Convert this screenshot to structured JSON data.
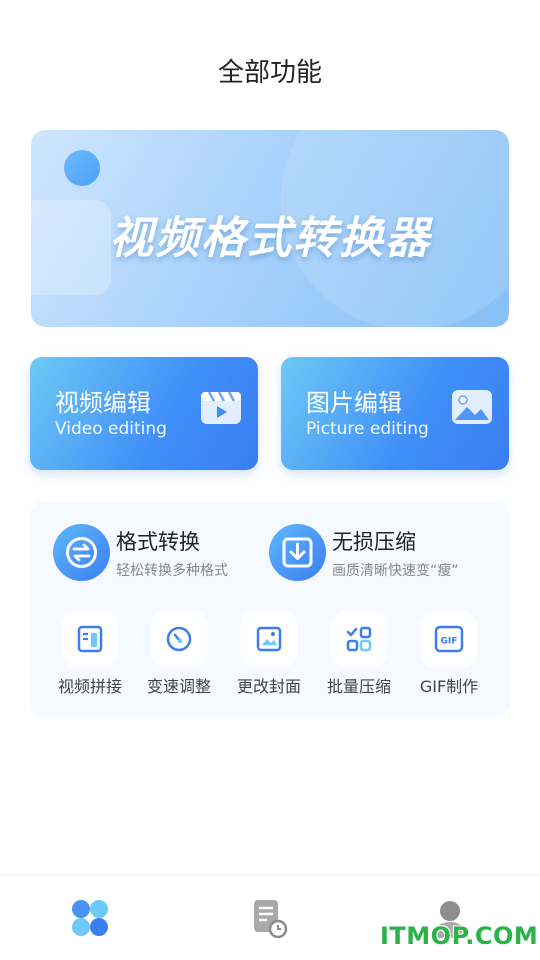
{
  "header": {
    "title": "全部功能"
  },
  "banner": {
    "text": "视频格式转换器"
  },
  "cards": [
    {
      "title": "视频编辑",
      "subtitle": "Video editing",
      "icon": "video-clapper-icon"
    },
    {
      "title": "图片编辑",
      "subtitle": "Picture editing",
      "icon": "image-icon"
    }
  ],
  "features": [
    {
      "title": "格式转换",
      "subtitle": "轻松转换多种格式",
      "icon": "convert-icon"
    },
    {
      "title": "无损压缩",
      "subtitle": "画质清晰快速变“瘦”",
      "icon": "compress-download-icon"
    }
  ],
  "tools": [
    {
      "label": "视频拼接",
      "icon": "video-splice-icon"
    },
    {
      "label": "变速调整",
      "icon": "speed-gauge-icon"
    },
    {
      "label": "更改封面",
      "icon": "cover-image-icon"
    },
    {
      "label": "批量压缩",
      "icon": "batch-grid-icon"
    },
    {
      "label": "GIF制作",
      "icon": "gif-icon",
      "badge": "GIF"
    }
  ],
  "tabbar": [
    {
      "icon": "home-clover-icon",
      "active": true
    },
    {
      "icon": "document-history-icon",
      "active": false
    },
    {
      "icon": "user-profile-icon",
      "active": false
    }
  ],
  "watermark": "ITMOP.COM",
  "colors": {
    "accent": "#3a7ef2",
    "accent_light": "#6ec9f6",
    "panel_bg": "#f6f9ff",
    "watermark": "#2bb34a"
  }
}
